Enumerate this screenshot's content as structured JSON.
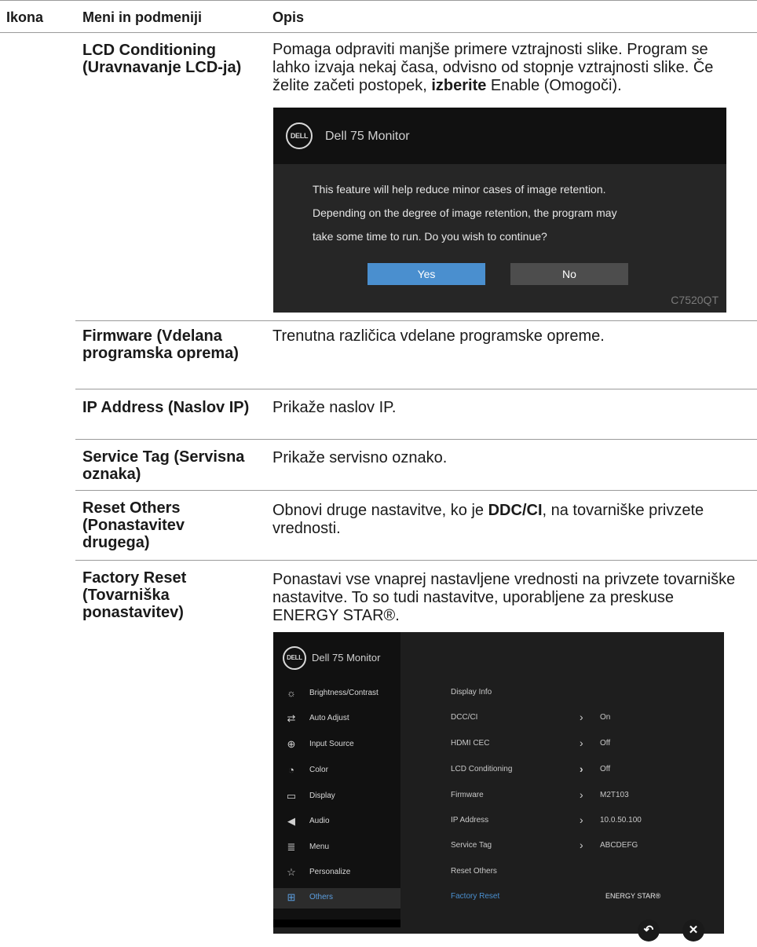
{
  "header": {
    "col_icon": "Ikona",
    "col_menu": "Meni in podmeniji",
    "col_desc": "Opis"
  },
  "rows": [
    {
      "menu": "LCD Conditioning (Uravnavanje LCD-ja)",
      "desc_before": "Pomaga odpraviti manjše primere vztrajnosti slike. Program se lahko izvaja nekaj časa, odvisno od stopnje vztrajnosti slike. Če želite začeti postopek, ",
      "desc_bold": "izberite",
      "desc_after": " Enable (Omogoči)."
    },
    {
      "menu": "Firmware (Vdelana programska oprema)",
      "desc": "Trenutna različica vdelane programske opreme."
    },
    {
      "menu": "IP Address (Naslov IP)",
      "desc": "Prikaže naslov IP."
    },
    {
      "menu": "Service Tag (Servisna oznaka)",
      "desc": "Prikaže servisno oznako."
    },
    {
      "menu": "Reset Others (Ponastavitev drugega)",
      "desc_before": "Obnovi druge nastavitve, ko je ",
      "desc_bold": "DDC/CI",
      "desc_after": ", na tovarniške privzete vrednosti."
    },
    {
      "menu": "Factory Reset (Tovarniška ponastavitev)",
      "desc": "Ponastavi vse vnaprej nastavljene vrednosti na privzete tovarniške nastavitve. To so tudi nastavitve, uporabljene za preskuse ENERGY STAR®."
    }
  ],
  "dialog": {
    "logo": "DELL",
    "title": "Dell 75 Monitor",
    "message_lines": [
      "This feature will help reduce minor cases of image retention.",
      "Depending on the degree of image retention, the program may",
      "take some time to run. Do you wish to continue?"
    ],
    "yes_label": "Yes",
    "no_label": "No",
    "model": "C7520QT",
    "colors": {
      "yes": "#4a8fcf",
      "no": "#4d4d4d",
      "background": "#262626"
    }
  },
  "osd": {
    "logo": "DELL",
    "title": "Dell 75 Monitor",
    "menu": [
      {
        "label": "Brightness/Contrast",
        "icon": "brightness-icon"
      },
      {
        "label": "Auto Adjust",
        "icon": "auto-adjust-icon"
      },
      {
        "label": "Input Source",
        "icon": "input-source-icon"
      },
      {
        "label": "Color",
        "icon": "color-palette-icon"
      },
      {
        "label": "Display",
        "icon": "display-icon"
      },
      {
        "label": "Audio",
        "icon": "speaker-icon"
      },
      {
        "label": "Menu",
        "icon": "menu-list-icon"
      },
      {
        "label": "Personalize",
        "icon": "star-icon"
      },
      {
        "label": "Others",
        "icon": "others-icon",
        "active": true
      }
    ],
    "rows": [
      {
        "label": "Display Info",
        "value": ""
      },
      {
        "label": "DCC/CI",
        "value": "On"
      },
      {
        "label": "HDMI CEC",
        "value": "Off"
      },
      {
        "label": "LCD Conditioning",
        "value": "Off"
      },
      {
        "label": "Firmware",
        "value": "M2T103"
      },
      {
        "label": "IP Address",
        "value": "10.0.50.100"
      },
      {
        "label": "Service Tag",
        "value": "ABCDEFG"
      },
      {
        "label": "Reset Others",
        "value": ""
      },
      {
        "label": "Factory Reset",
        "value": "ENERGY STAR®",
        "active": true
      }
    ],
    "active_color": "#4a8fcf"
  },
  "nav_buttons": {
    "back": "back-icon",
    "close": "close-icon"
  }
}
